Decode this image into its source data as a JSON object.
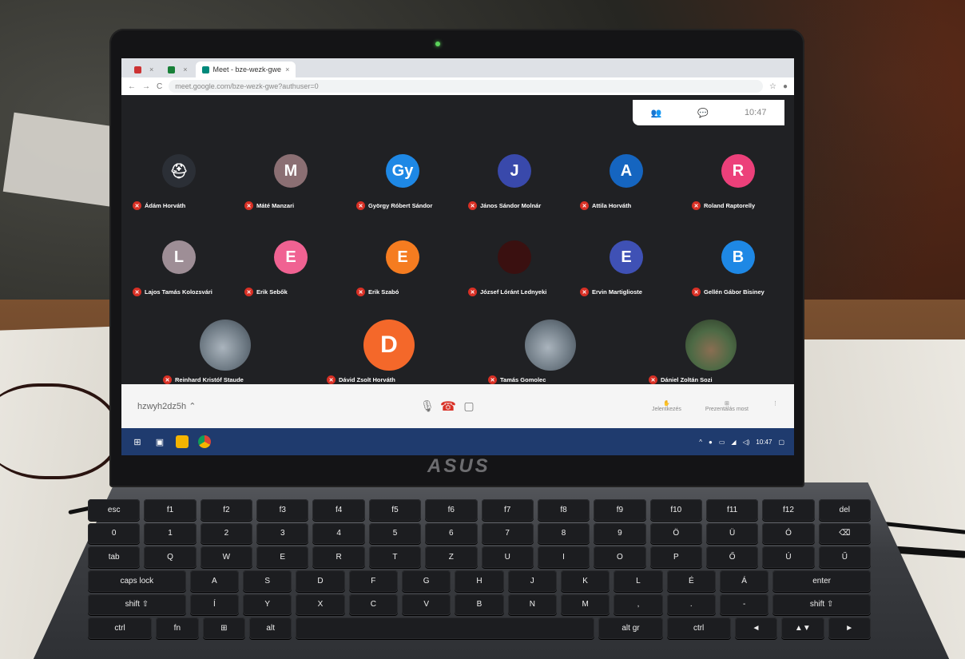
{
  "browser": {
    "tabs": [
      {
        "label": "",
        "active": false
      },
      {
        "label": "",
        "active": false
      },
      {
        "label": "Meet - bze-wezk-gwe",
        "active": true
      }
    ],
    "url": "meet.google.com/bze-wezk-gwe?authuser=0"
  },
  "meet": {
    "time": "10:47",
    "participants": [
      {
        "name": "Ádám Horváth",
        "initial": "",
        "color": "#2b2f36",
        "icon": "avatar-robot-icon"
      },
      {
        "name": "Máté Manzari",
        "initial": "M",
        "color": "#8b6f73"
      },
      {
        "name": "György Róbert Sándor",
        "initial": "Gy",
        "color": "#1e88e5"
      },
      {
        "name": "János Sándor Molnár",
        "initial": "J",
        "color": "#3949ab"
      },
      {
        "name": "Attila Horváth",
        "initial": "A",
        "color": "#1565c0"
      },
      {
        "name": "Roland Raptorelly",
        "initial": "R",
        "color": "#ec407a"
      },
      {
        "name": "Lajos Tamás Kolozsvári",
        "initial": "L",
        "color": "#9e8e96"
      },
      {
        "name": "Erik Sebők",
        "initial": "E",
        "color": "#f06292"
      },
      {
        "name": "Erik Szabó",
        "initial": "E",
        "color": "#f57c20"
      },
      {
        "name": "József Lóránt Lednyeki",
        "initial": "",
        "color": "#3a1010"
      },
      {
        "name": "Ervin Martiglioste",
        "initial": "E",
        "color": "#3f51b5"
      },
      {
        "name": "Gellén Gábor Bisiney",
        "initial": "B",
        "color": "#1e88e5"
      },
      {
        "name": "Reinhard Kristóf Staude",
        "initial": "",
        "color": "",
        "photo": "photo-car"
      },
      {
        "name": "Dávid Zsolt Horváth",
        "initial": "D",
        "color": "#f4682a",
        "big": true
      },
      {
        "name": "Tamás Gomolec",
        "initial": "",
        "color": "",
        "photo": "photo-car"
      },
      {
        "name": "Dániel Zoltán Sozi",
        "initial": "",
        "color": "",
        "photo": "photo-outdoor"
      }
    ],
    "meeting_code": "hzwyh2dz5h",
    "controls": {
      "raise_hand": "Jelentkezés",
      "present": "Prezentálás most"
    }
  },
  "laptop": {
    "brand": "ASUS"
  },
  "keyboard": {
    "rows": [
      [
        "esc",
        "f1",
        "f2",
        "f3",
        "f4",
        "f5",
        "f6",
        "f7",
        "f8",
        "f9",
        "f10",
        "f11",
        "f12",
        "del"
      ],
      [
        "0",
        "1",
        "2",
        "3",
        "4",
        "5",
        "6",
        "7",
        "8",
        "9",
        "Ö",
        "Ü",
        "Ó",
        "⌫"
      ],
      [
        "tab",
        "Q",
        "W",
        "E",
        "R",
        "T",
        "Z",
        "U",
        "I",
        "O",
        "P",
        "Ő",
        "Ú",
        "Ű"
      ],
      [
        "caps lock",
        "A",
        "S",
        "D",
        "F",
        "G",
        "H",
        "J",
        "K",
        "L",
        "É",
        "Á",
        "enter"
      ],
      [
        "shift ⇧",
        "Í",
        "Y",
        "X",
        "C",
        "V",
        "B",
        "N",
        "M",
        ",",
        ".",
        "-",
        "shift ⇧"
      ],
      [
        "ctrl",
        "fn",
        "⊞",
        "alt",
        " ",
        "alt gr",
        "ctrl",
        "◄",
        "▲▼",
        "►"
      ]
    ]
  }
}
